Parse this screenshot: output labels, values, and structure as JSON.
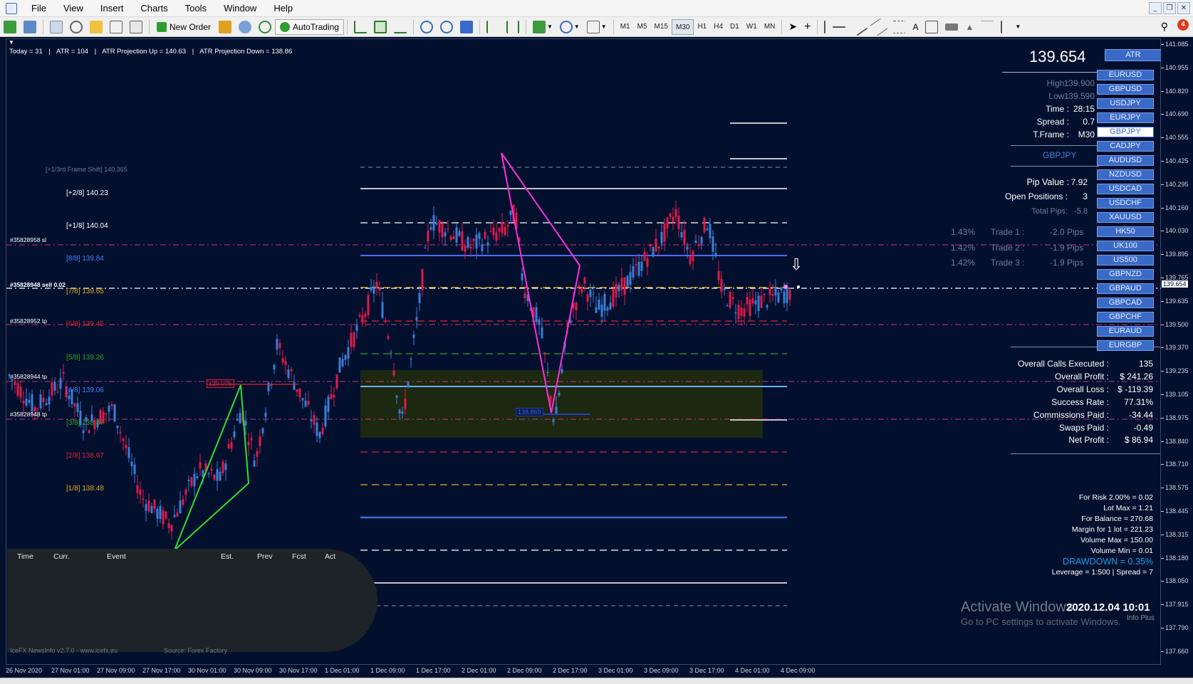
{
  "menu": [
    "File",
    "View",
    "Insert",
    "Charts",
    "Tools",
    "Window",
    "Help"
  ],
  "toolbar": {
    "new_order": "New Order",
    "autotrading": "AutoTrading",
    "timeframes": [
      "M1",
      "M5",
      "M15",
      "M30",
      "H1",
      "H4",
      "D1",
      "W1",
      "MN"
    ],
    "active_timeframe": "M30",
    "notification_count": "4"
  },
  "header_stats": {
    "today": "Today = 31",
    "atr": "ATR = 104",
    "atr_up": "ATR Projection Up = 140.63",
    "atr_down": "ATR Projection Down = 138.86"
  },
  "frame_shift": "[+1/3rd Frame Shift]  140.365",
  "murrey_levels": [
    {
      "label": "[+2/8]",
      "value": "140.23",
      "color": "#ffffff"
    },
    {
      "label": "[+1/8]",
      "value": "140.04",
      "color": "#ffffff"
    },
    {
      "label": "[8/8]",
      "value": "139.84",
      "color": "#4a7bff"
    },
    {
      "label": "[7/8]",
      "value": "139.65",
      "color": "#e6a820"
    },
    {
      "label": "[6/8]",
      "value": "139.45",
      "color": "#e02030"
    },
    {
      "label": "[5/8]",
      "value": "139.26",
      "color": "#2ea020"
    },
    {
      "label": "[4/8]",
      "value": "139.06",
      "color": "#4a7bff"
    },
    {
      "label": "[3/8]",
      "value": "138.87",
      "color": "#2ea020"
    },
    {
      "label": "[2/8]",
      "value": "138.67",
      "color": "#e02030"
    },
    {
      "label": "[1/8]",
      "value": "138.48",
      "color": "#e6a820"
    }
  ],
  "order_tags": [
    {
      "text": "#35828958 sl"
    },
    {
      "text": "#35828948 sell 0.02"
    },
    {
      "text": "#35828952 tp"
    },
    {
      "text": "#35828944 tp"
    },
    {
      "text": "#35828948 tp"
    }
  ],
  "pattern_labels": {
    "red_box": "139.076",
    "blue_box": "138.869"
  },
  "panel": {
    "price": "139.654",
    "atr_button": "ATR",
    "rows": [
      {
        "k": "High :",
        "v": "139.900",
        "dim": true
      },
      {
        "k": "Low :",
        "v": "139.590",
        "dim": true
      },
      {
        "k": "Time :",
        "v": "28:15",
        "dim": false
      },
      {
        "k": "Spread :",
        "v": "0.7",
        "dim": false
      },
      {
        "k": "T.Frame :",
        "v": "M30",
        "dim": false
      }
    ],
    "symbol": "GBPJPY",
    "pip_value_k": "Pip Value :",
    "pip_value_v": "7.92",
    "open_pos_k": "Open Positions :",
    "open_pos_v": "3",
    "total_pips_k": "Total Pips:",
    "total_pips_v": "-5.8",
    "trades": [
      {
        "pct": "1.43%",
        "name": "Trade 1 :",
        "pips": "-2.0 Pips"
      },
      {
        "pct": "1.42%",
        "name": "Trade 2 :",
        "pips": "-1.9 Pips"
      },
      {
        "pct": "1.42%",
        "name": "Trade 3 :",
        "pips": "-1.9 Pips"
      }
    ],
    "stats": [
      {
        "k": "Overall Calls Executed :",
        "v": "135"
      },
      {
        "k": "Overall Profit :",
        "v": "$ 241.26"
      },
      {
        "k": "Overall Loss :",
        "v": "$ -119.39"
      },
      {
        "k": "Success Rate :",
        "v": "77.31%"
      },
      {
        "k": "Commissions Paid :",
        "v": "-34.44"
      },
      {
        "k": "Swaps Paid :",
        "v": "-0.49"
      },
      {
        "k": "Net Profit :",
        "v": "$ 86.94"
      }
    ],
    "risk": [
      "For Risk 2.00% = 0.02",
      "Lot Max = 1.21",
      "For Balance = 270.68",
      "Margin for 1 lot = 221.23",
      "Volume Max = 150.00",
      "Volume Min = 0.01"
    ],
    "drawdown": "DRAWDOWN =  0.35%",
    "leverage": "Leverage = 1:500 | Spread = 7"
  },
  "symbols": [
    "EURUSD",
    "GBPUSD",
    "USDJPY",
    "EURJPY",
    "GBPJPY",
    "CADJPY",
    "AUDUSD",
    "NZDUSD",
    "USDCAD",
    "USDCHF",
    "XAUUSD",
    "HK50",
    "UK100",
    "US500",
    "GBPNZD",
    "GBPAUD",
    "GBPCAD",
    "GBPCHF",
    "EURAUD",
    "EURGBP"
  ],
  "active_symbol": "GBPJPY",
  "news": {
    "headers": [
      "Time",
      "Curr.",
      "Event",
      "Est.",
      "Prev",
      "Fcst",
      "Act"
    ],
    "footer": "IceFX NewsInfo v2.7.0  -  www.icefx.eu",
    "source": "Source: Forex Factory"
  },
  "watermark": {
    "title": "Activate Windows",
    "sub": "Go to PC settings to activate Windows."
  },
  "datetime": "2020.12.04 10:01",
  "info_plus": "Info Plus",
  "price_axis": [
    "141.085",
    "140.955",
    "140.820",
    "140.690",
    "140.555",
    "140.425",
    "140.295",
    "140.160",
    "140.030",
    "139.895",
    "139.765",
    "139.635",
    "139.500",
    "139.370",
    "139.235",
    "139.105",
    "138.975",
    "138.840",
    "138.710",
    "138.575",
    "138.445",
    "138.315",
    "138.180",
    "138.050",
    "137.915",
    "137.790",
    "137.660"
  ],
  "current_price_tag": "139.654",
  "time_axis": [
    "26 Nov 2020",
    "27 Nov 01:00",
    "27 Nov 09:00",
    "27 Nov 17:00",
    "30 Nov 01:00",
    "30 Nov 09:00",
    "30 Nov 17:00",
    "1 Dec 01:00",
    "1 Dec 09:00",
    "1 Dec 17:00",
    "2 Dec 01:00",
    "2 Dec 09:00",
    "2 Dec 17:00",
    "3 Dec 01:00",
    "3 Dec 09:00",
    "3 Dec 17:00",
    "4 Dec 01:00",
    "4 Dec 09:00"
  ]
}
